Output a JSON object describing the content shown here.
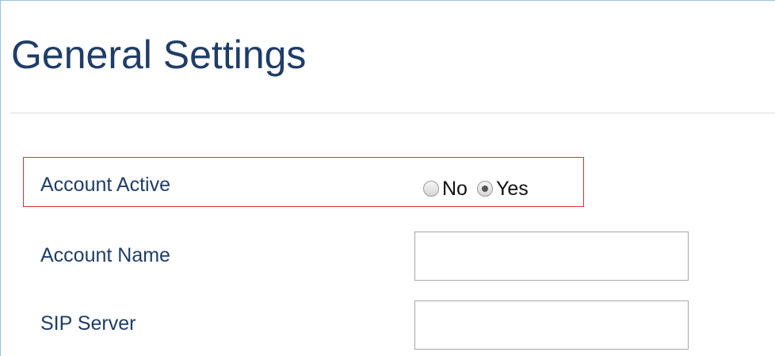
{
  "page": {
    "title": "General Settings"
  },
  "fields": {
    "account_active": {
      "label": "Account Active",
      "options": [
        {
          "label": "No",
          "selected": false
        },
        {
          "label": "Yes",
          "selected": true
        }
      ]
    },
    "account_name": {
      "label": "Account Name",
      "value": ""
    },
    "sip_server": {
      "label": "SIP Server",
      "value": ""
    }
  },
  "colors": {
    "title": "#1f3d68",
    "highlight_border": "#e0303a",
    "frame_border": "#9cc0e6"
  }
}
